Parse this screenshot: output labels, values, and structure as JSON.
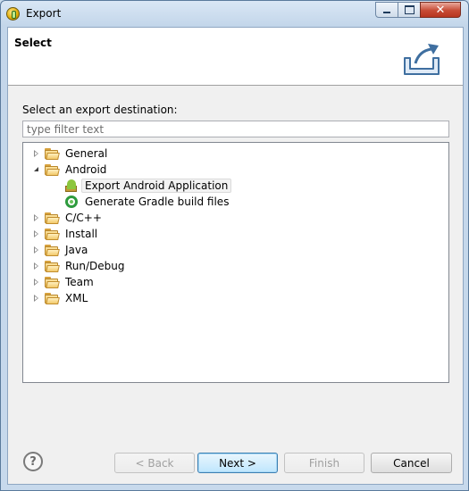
{
  "window": {
    "title": "Export"
  },
  "banner": {
    "title": "Select"
  },
  "prompt": "Select an export destination:",
  "filter": {
    "placeholder": "type filter text",
    "value": ""
  },
  "tree": {
    "items": [
      {
        "label": "General",
        "expanded": false
      },
      {
        "label": "Android",
        "expanded": true
      },
      {
        "label": "Export Android Application",
        "selected": true
      },
      {
        "label": "Generate Gradle build files"
      },
      {
        "label": "C/C++",
        "expanded": false
      },
      {
        "label": "Install",
        "expanded": false
      },
      {
        "label": "Java",
        "expanded": false
      },
      {
        "label": "Run/Debug",
        "expanded": false
      },
      {
        "label": "Team",
        "expanded": false
      },
      {
        "label": "XML",
        "expanded": false
      }
    ]
  },
  "buttons": {
    "back": "< Back",
    "next": "Next >",
    "finish": "Finish",
    "cancel": "Cancel"
  },
  "colors": {
    "default_button_border": "#3c7fb1",
    "close_button": "#c74b35"
  }
}
